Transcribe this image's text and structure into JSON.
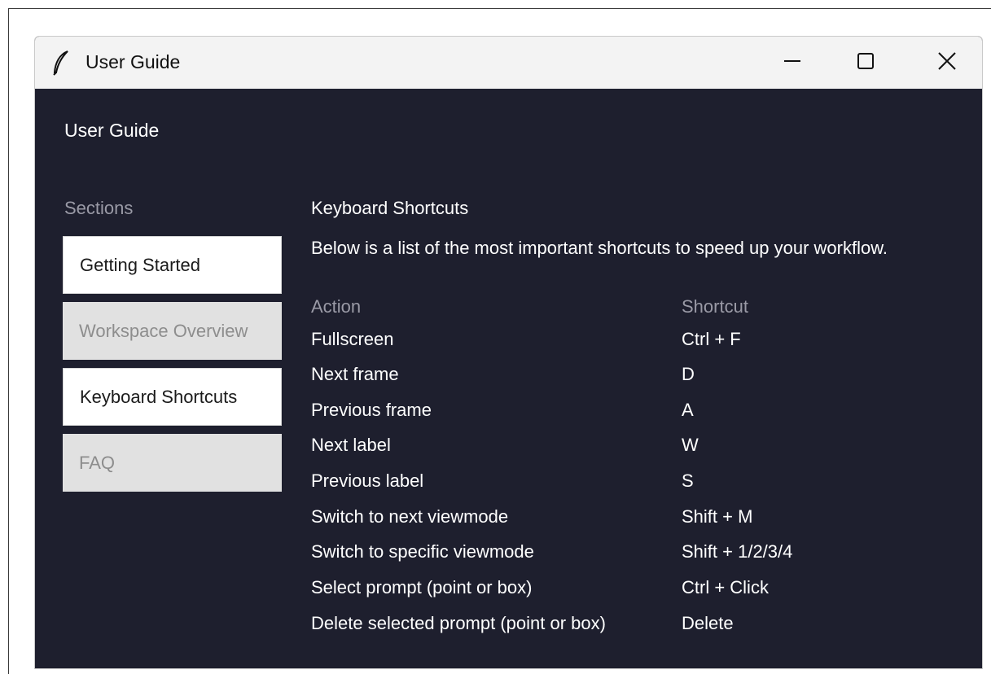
{
  "window": {
    "title": "User Guide",
    "controls": {
      "minimize": "minimize-icon",
      "maximize": "maximize-icon",
      "close": "close-icon"
    }
  },
  "header": {
    "title": "User Guide"
  },
  "sidebar": {
    "label": "Sections",
    "items": [
      {
        "label": "Getting Started",
        "state": "active"
      },
      {
        "label": "Workspace Overview",
        "state": "inactive"
      },
      {
        "label": "Keyboard Shortcuts",
        "state": "active"
      },
      {
        "label": "FAQ",
        "state": "inactive"
      }
    ]
  },
  "main": {
    "title": "Keyboard Shortcuts",
    "description": "Below is a list of the most important shortcuts to speed up your workflow.",
    "columns": {
      "action": "Action",
      "shortcut": "Shortcut"
    },
    "rows": [
      {
        "action": "Fullscreen",
        "shortcut": "Ctrl + F"
      },
      {
        "action": "Next frame",
        "shortcut": "D"
      },
      {
        "action": "Previous frame",
        "shortcut": "A"
      },
      {
        "action": "Next label",
        "shortcut": "W"
      },
      {
        "action": "Previous label",
        "shortcut": "S"
      },
      {
        "action": "Switch to next viewmode",
        "shortcut": "Shift + M"
      },
      {
        "action": "Switch to specific viewmode",
        "shortcut": "Shift + 1/2/3/4"
      },
      {
        "action": "Select prompt (point or box)",
        "shortcut": "Ctrl + Click"
      },
      {
        "action": "Delete selected prompt (point or box)",
        "shortcut": "Delete"
      }
    ]
  },
  "colors": {
    "background": "#1e1f2e",
    "titlebar": "#f3f3f3",
    "muted_text": "#9a9aa6",
    "nav_active_bg": "#ffffff",
    "nav_inactive_bg": "#e1e1e1"
  }
}
